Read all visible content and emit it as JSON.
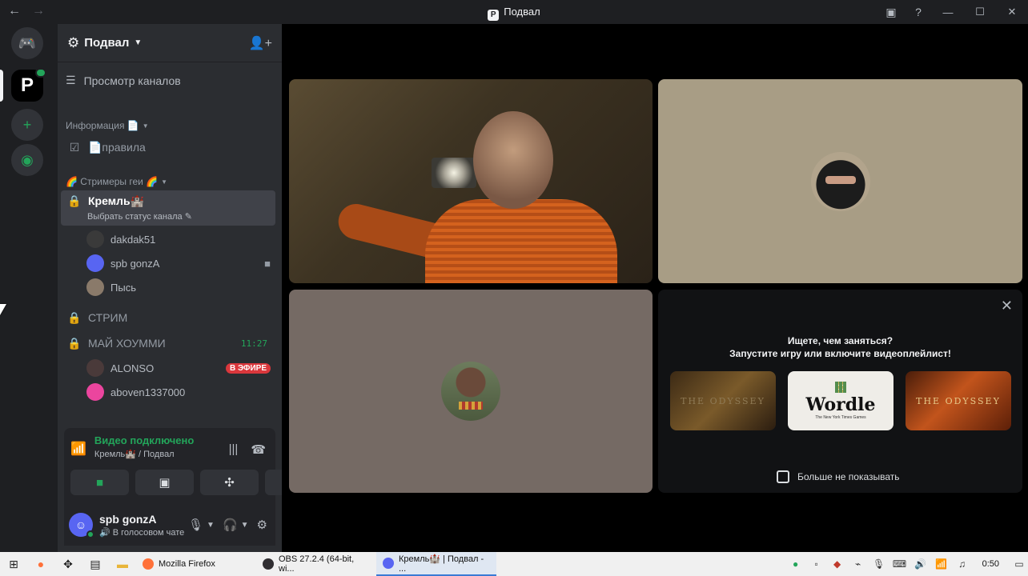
{
  "window": {
    "title": "Подвал"
  },
  "server": {
    "name": "Подвал",
    "browse_label": "Просмотр каналов",
    "categories": [
      {
        "label": "Информация 📄"
      },
      {
        "label": "🌈 Стримеры геи 🌈"
      }
    ],
    "channels": {
      "rules": {
        "label": "📄правила"
      },
      "kremlin": {
        "label": "Кремль🏰",
        "sub": "Выбрать статус канала ✎"
      },
      "stream": {
        "label": "СТРИМ"
      },
      "myhome": {
        "label": "МАЙ ХОУММИ",
        "time": "11:27"
      }
    },
    "kremlin_members": [
      {
        "name": "dakdak51",
        "color": "#3a3a3a"
      },
      {
        "name": "spb gonzA",
        "color": "#5865f2",
        "right_icon": "camera-icon"
      },
      {
        "name": "Пысь",
        "color": "#8a7a6a"
      }
    ],
    "myhome_members": [
      {
        "name": "ALONSO",
        "color": "#4a3a3a",
        "badge": "В ЭФИРЕ"
      },
      {
        "name": "aboven1337000",
        "color": "#eb459e"
      }
    ]
  },
  "voice": {
    "status": "Видео подключено",
    "location": "Кремль🏰 / Подвал"
  },
  "user": {
    "name": "spb gonzA",
    "status": "🔊 В голосовом чате"
  },
  "activity": {
    "title_line1": "Ищете, чем заняться?",
    "title_line2": "Запустите игру или включите видеоплейлист!",
    "cards": [
      {
        "name": "THE ODYSSEY"
      },
      {
        "name": "Wordle",
        "sub": "The New York Times Games"
      },
      {
        "name": "THE ODYSSEY"
      }
    ],
    "dont_show": "Больше не показывать"
  },
  "taskbar": {
    "apps": [
      {
        "label": "Mozilla Firefox",
        "color": "#ff7139"
      },
      {
        "label": "OBS 27.2.4 (64-bit, wi...",
        "color": "#302e31"
      },
      {
        "label": "Кремль🏰 | Подвал - ...",
        "color": "#5865f2"
      }
    ],
    "clock": "0:50"
  }
}
